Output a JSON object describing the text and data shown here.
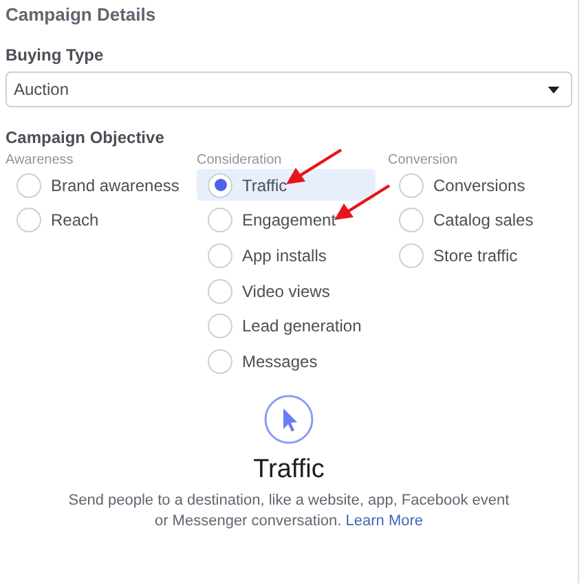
{
  "section_title": "Campaign Details",
  "buying_type": {
    "label": "Buying Type",
    "value": "Auction"
  },
  "objective": {
    "label": "Campaign Objective",
    "groups": [
      {
        "heading": "Awareness",
        "options": [
          {
            "label": "Brand awareness",
            "selected": false,
            "arrow": false
          },
          {
            "label": "Reach",
            "selected": false,
            "arrow": false
          }
        ]
      },
      {
        "heading": "Consideration",
        "options": [
          {
            "label": "Traffic",
            "selected": true,
            "arrow": true
          },
          {
            "label": "Engagement",
            "selected": false,
            "arrow": true
          },
          {
            "label": "App installs",
            "selected": false,
            "arrow": false
          },
          {
            "label": "Video views",
            "selected": false,
            "arrow": false
          },
          {
            "label": "Lead generation",
            "selected": false,
            "arrow": false
          },
          {
            "label": "Messages",
            "selected": false,
            "arrow": false
          }
        ]
      },
      {
        "heading": "Conversion",
        "options": [
          {
            "label": "Conversions",
            "selected": false,
            "arrow": false
          },
          {
            "label": "Catalog sales",
            "selected": false,
            "arrow": false
          },
          {
            "label": "Store traffic",
            "selected": false,
            "arrow": false
          }
        ]
      }
    ]
  },
  "detail": {
    "title": "Traffic",
    "description": "Send people to a destination, like a website, app, Facebook event or Messenger conversation.",
    "link": "Learn More"
  }
}
